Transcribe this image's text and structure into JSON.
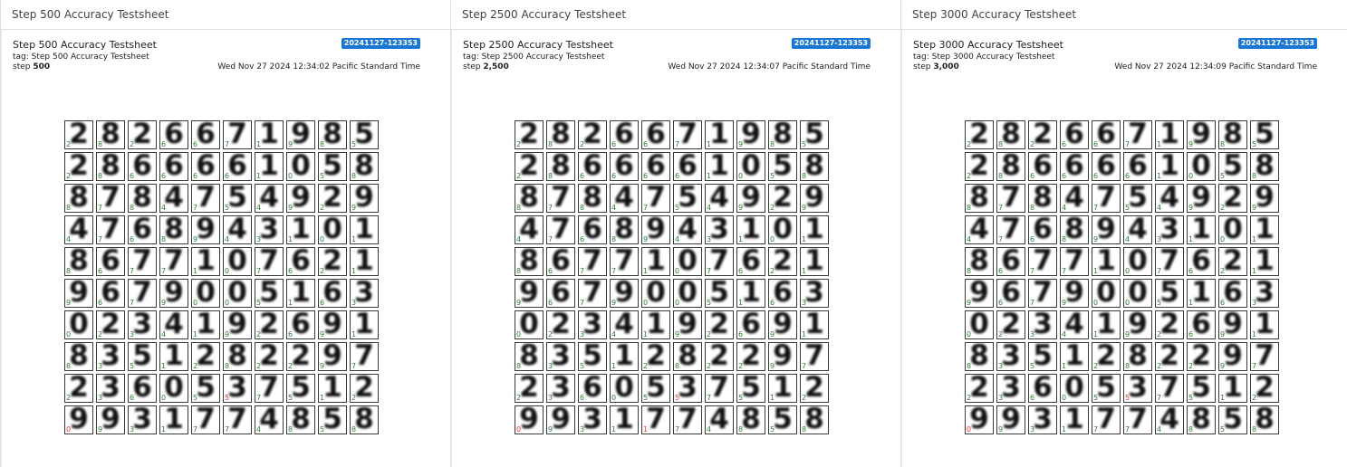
{
  "panels": [
    {
      "header": "Step 500 Accuracy Testsheet",
      "title": "Step 500 Accuracy Testsheet",
      "run": "20241127-123353",
      "tag": "tag: Step 500 Accuracy Testsheet",
      "step_label": "step",
      "step_value": "500",
      "time": "Wed Nov 27 2024 12:34:02 Pacific Standard Time",
      "grid": {
        "digits": [
          [
            "2",
            "8",
            "2",
            "6",
            "6",
            "7",
            "1",
            "9",
            "8",
            "5"
          ],
          [
            "2",
            "8",
            "6",
            "6",
            "6",
            "6",
            "1",
            "0",
            "5",
            "8"
          ],
          [
            "8",
            "7",
            "8",
            "4",
            "7",
            "5",
            "4",
            "9",
            "2",
            "9"
          ],
          [
            "4",
            "7",
            "6",
            "8",
            "9",
            "4",
            "3",
            "1",
            "0",
            "1"
          ],
          [
            "8",
            "6",
            "7",
            "7",
            "1",
            "0",
            "7",
            "6",
            "2",
            "1"
          ],
          [
            "9",
            "6",
            "7",
            "9",
            "0",
            "0",
            "5",
            "1",
            "6",
            "3"
          ],
          [
            "0",
            "2",
            "3",
            "4",
            "1",
            "9",
            "2",
            "6",
            "9",
            "1"
          ],
          [
            "8",
            "3",
            "5",
            "1",
            "2",
            "8",
            "2",
            "2",
            "9",
            "7"
          ],
          [
            "2",
            "3",
            "6",
            "0",
            "5",
            "3",
            "7",
            "5",
            "1",
            "2"
          ],
          [
            "9",
            "9",
            "3",
            "1",
            "7",
            "7",
            "4",
            "8",
            "5",
            "8"
          ]
        ],
        "labels": [
          [
            "2",
            "8",
            "2",
            "6",
            "6",
            "7",
            "1",
            "9",
            "8",
            "5"
          ],
          [
            "2",
            "8",
            "6",
            "6",
            "6",
            "6",
            "1",
            "0",
            "5",
            "8"
          ],
          [
            "8",
            "7",
            "8",
            "4",
            "7",
            "5",
            "4",
            "9",
            "2",
            "9"
          ],
          [
            "4",
            "7",
            "6",
            "8",
            "9",
            "4",
            "3",
            "1",
            "0",
            "1"
          ],
          [
            "8",
            "6",
            "7",
            "7",
            "1",
            "0",
            "7",
            "6",
            "2",
            "1"
          ],
          [
            "9",
            "6",
            "7",
            "9",
            "0",
            "0",
            "5",
            "1",
            "6",
            "3"
          ],
          [
            "0",
            "2",
            "3",
            "4",
            "1",
            "9",
            "2",
            "6",
            "9",
            "1"
          ],
          [
            "8",
            "3",
            "5",
            "1",
            "2",
            "8",
            "2",
            "2",
            "9",
            "7"
          ],
          [
            "2",
            "3",
            "6",
            "0",
            "5",
            "5",
            "7",
            "5",
            "1",
            "2"
          ],
          [
            "0",
            "9",
            "3",
            "1",
            "7",
            "7",
            "4",
            "8",
            "5",
            "8"
          ]
        ],
        "wrong": [
          [
            8,
            5
          ],
          [
            9,
            0
          ]
        ]
      }
    },
    {
      "header": "Step 2500 Accuracy Testsheet",
      "title": "Step 2500 Accuracy Testsheet",
      "run": "20241127-123353",
      "tag": "tag: Step 2500 Accuracy Testsheet",
      "step_label": "step",
      "step_value": "2,500",
      "time": "Wed Nov 27 2024 12:34:07 Pacific Standard Time",
      "grid": {
        "digits": [
          [
            "2",
            "8",
            "2",
            "6",
            "6",
            "7",
            "1",
            "9",
            "8",
            "5"
          ],
          [
            "2",
            "8",
            "6",
            "6",
            "6",
            "6",
            "1",
            "0",
            "5",
            "8"
          ],
          [
            "8",
            "7",
            "8",
            "4",
            "7",
            "5",
            "4",
            "9",
            "2",
            "9"
          ],
          [
            "4",
            "7",
            "6",
            "8",
            "9",
            "4",
            "3",
            "1",
            "0",
            "1"
          ],
          [
            "8",
            "6",
            "7",
            "7",
            "1",
            "0",
            "7",
            "6",
            "2",
            "1"
          ],
          [
            "9",
            "6",
            "7",
            "9",
            "0",
            "0",
            "5",
            "1",
            "6",
            "3"
          ],
          [
            "0",
            "2",
            "3",
            "4",
            "1",
            "9",
            "2",
            "6",
            "9",
            "1"
          ],
          [
            "8",
            "3",
            "5",
            "1",
            "2",
            "8",
            "2",
            "2",
            "9",
            "7"
          ],
          [
            "2",
            "3",
            "6",
            "0",
            "5",
            "3",
            "7",
            "5",
            "1",
            "2"
          ],
          [
            "9",
            "9",
            "3",
            "1",
            "7",
            "7",
            "4",
            "8",
            "5",
            "8"
          ]
        ],
        "labels": [
          [
            "2",
            "8",
            "2",
            "6",
            "6",
            "7",
            "1",
            "9",
            "8",
            "5"
          ],
          [
            "2",
            "8",
            "6",
            "6",
            "6",
            "6",
            "1",
            "0",
            "5",
            "8"
          ],
          [
            "8",
            "7",
            "8",
            "4",
            "7",
            "5",
            "4",
            "9",
            "2",
            "9"
          ],
          [
            "4",
            "7",
            "6",
            "8",
            "9",
            "4",
            "3",
            "1",
            "0",
            "1"
          ],
          [
            "8",
            "6",
            "7",
            "7",
            "1",
            "0",
            "7",
            "6",
            "2",
            "1"
          ],
          [
            "9",
            "6",
            "7",
            "9",
            "0",
            "0",
            "5",
            "1",
            "6",
            "3"
          ],
          [
            "0",
            "2",
            "3",
            "4",
            "1",
            "9",
            "2",
            "6",
            "9",
            "1"
          ],
          [
            "8",
            "3",
            "5",
            "1",
            "2",
            "8",
            "2",
            "2",
            "9",
            "7"
          ],
          [
            "2",
            "3",
            "6",
            "0",
            "5",
            "5",
            "7",
            "5",
            "1",
            "2"
          ],
          [
            "0",
            "9",
            "3",
            "1",
            "1",
            "7",
            "4",
            "8",
            "5",
            "8"
          ]
        ],
        "wrong": [
          [
            8,
            5
          ],
          [
            9,
            0
          ],
          [
            9,
            4
          ]
        ]
      }
    },
    {
      "header": "Step 3000 Accuracy Testsheet",
      "title": "Step 3000 Accuracy Testsheet",
      "run": "20241127-123353",
      "tag": "tag: Step 3000 Accuracy Testsheet",
      "step_label": "step",
      "step_value": "3,000",
      "time": "Wed Nov 27 2024 12:34:09 Pacific Standard Time",
      "grid": {
        "digits": [
          [
            "2",
            "8",
            "2",
            "6",
            "6",
            "7",
            "1",
            "9",
            "8",
            "5"
          ],
          [
            "2",
            "8",
            "6",
            "6",
            "6",
            "6",
            "1",
            "0",
            "5",
            "8"
          ],
          [
            "8",
            "7",
            "8",
            "4",
            "7",
            "5",
            "4",
            "9",
            "2",
            "9"
          ],
          [
            "4",
            "7",
            "6",
            "8",
            "9",
            "4",
            "3",
            "1",
            "0",
            "1"
          ],
          [
            "8",
            "6",
            "7",
            "7",
            "1",
            "0",
            "7",
            "6",
            "2",
            "1"
          ],
          [
            "9",
            "6",
            "7",
            "9",
            "0",
            "0",
            "5",
            "1",
            "6",
            "3"
          ],
          [
            "0",
            "2",
            "3",
            "4",
            "1",
            "9",
            "2",
            "6",
            "9",
            "1"
          ],
          [
            "8",
            "3",
            "5",
            "1",
            "2",
            "8",
            "2",
            "2",
            "9",
            "7"
          ],
          [
            "2",
            "3",
            "6",
            "0",
            "5",
            "3",
            "7",
            "5",
            "1",
            "2"
          ],
          [
            "9",
            "9",
            "3",
            "1",
            "7",
            "7",
            "4",
            "8",
            "5",
            "8"
          ]
        ],
        "labels": [
          [
            "2",
            "8",
            "2",
            "6",
            "6",
            "7",
            "1",
            "9",
            "8",
            "5"
          ],
          [
            "2",
            "8",
            "6",
            "6",
            "6",
            "6",
            "1",
            "0",
            "5",
            "8"
          ],
          [
            "8",
            "7",
            "8",
            "4",
            "7",
            "5",
            "4",
            "9",
            "2",
            "9"
          ],
          [
            "4",
            "7",
            "6",
            "8",
            "9",
            "4",
            "3",
            "1",
            "0",
            "1"
          ],
          [
            "8",
            "6",
            "7",
            "7",
            "1",
            "0",
            "7",
            "6",
            "2",
            "1"
          ],
          [
            "9",
            "6",
            "7",
            "9",
            "0",
            "0",
            "5",
            "1",
            "6",
            "3"
          ],
          [
            "0",
            "2",
            "3",
            "4",
            "1",
            "9",
            "2",
            "6",
            "9",
            "1"
          ],
          [
            "8",
            "3",
            "5",
            "1",
            "2",
            "8",
            "2",
            "2",
            "9",
            "7"
          ],
          [
            "2",
            "3",
            "6",
            "0",
            "5",
            "5",
            "7",
            "5",
            "1",
            "2"
          ],
          [
            "0",
            "9",
            "3",
            "1",
            "7",
            "7",
            "4",
            "8",
            "5",
            "8"
          ]
        ],
        "wrong": [
          [
            8,
            5
          ],
          [
            9,
            0
          ]
        ]
      }
    }
  ],
  "colors": {
    "correct_label": "#2e7d32",
    "wrong_label": "#e53935",
    "run_badge": "#1976d2"
  }
}
